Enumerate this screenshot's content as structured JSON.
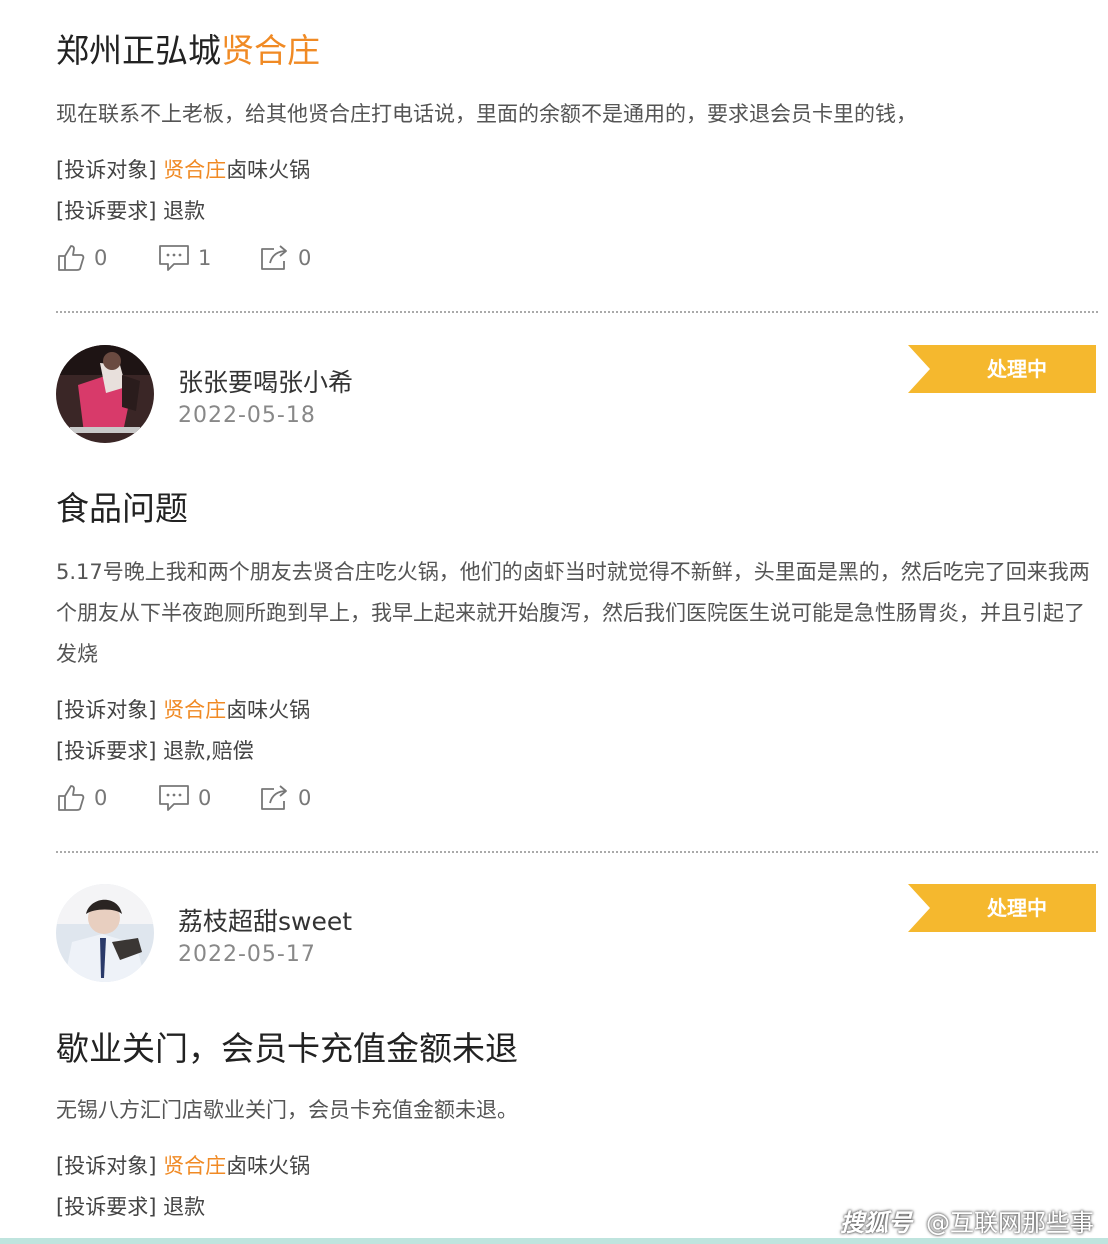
{
  "complaints": [
    {
      "title_prefix": "郑州正弘城",
      "title_highlight": "贤合庄",
      "description": "现在联系不上老板，给其他贤合庄打电话说，里面的余额不是通用的，要求退会员卡里的钱，",
      "target_label": "[投诉对象]",
      "target_highlight": "贤合庄",
      "target_rest": "卤味火锅",
      "demand_label": "[投诉要求]",
      "demand_value": "退款",
      "likes": "0",
      "comments": "1",
      "shares": "0"
    },
    {
      "username": "张张要喝张小希",
      "date": "2022-05-18",
      "status": "处理中",
      "title": "食品问题",
      "description": "5.17号晚上我和两个朋友去贤合庄吃火锅，他们的卤虾当时就觉得不新鲜，头里面是黑的，然后吃完了回来我两个朋友从下半夜跑厕所跑到早上，我早上起来就开始腹泻，然后我们医院医生说可能是急性肠胃炎，并且引起了发烧",
      "target_label": "[投诉对象]",
      "target_highlight": "贤合庄",
      "target_rest": "卤味火锅",
      "demand_label": "[投诉要求]",
      "demand_value": "退款,赔偿",
      "likes": "0",
      "comments": "0",
      "shares": "0"
    },
    {
      "username": "荔枝超甜sweet",
      "date": "2022-05-17",
      "status": "处理中",
      "title": "歇业关门，会员卡充值金额未退",
      "description": "无锡八方汇门店歇业关门，会员卡充值金额未退。",
      "target_label": "[投诉对象]",
      "target_highlight": "贤合庄",
      "target_rest": "卤味火锅",
      "demand_label": "[投诉要求]",
      "demand_value": "退款"
    }
  ],
  "watermark": {
    "logo": "搜狐号",
    "account": "@互联网那些事"
  },
  "colors": {
    "highlight": "#f08a24",
    "badge": "#f5b82e",
    "bottom_bar": "#bfe4de"
  },
  "icons": [
    "like-icon",
    "comment-icon",
    "share-icon"
  ]
}
